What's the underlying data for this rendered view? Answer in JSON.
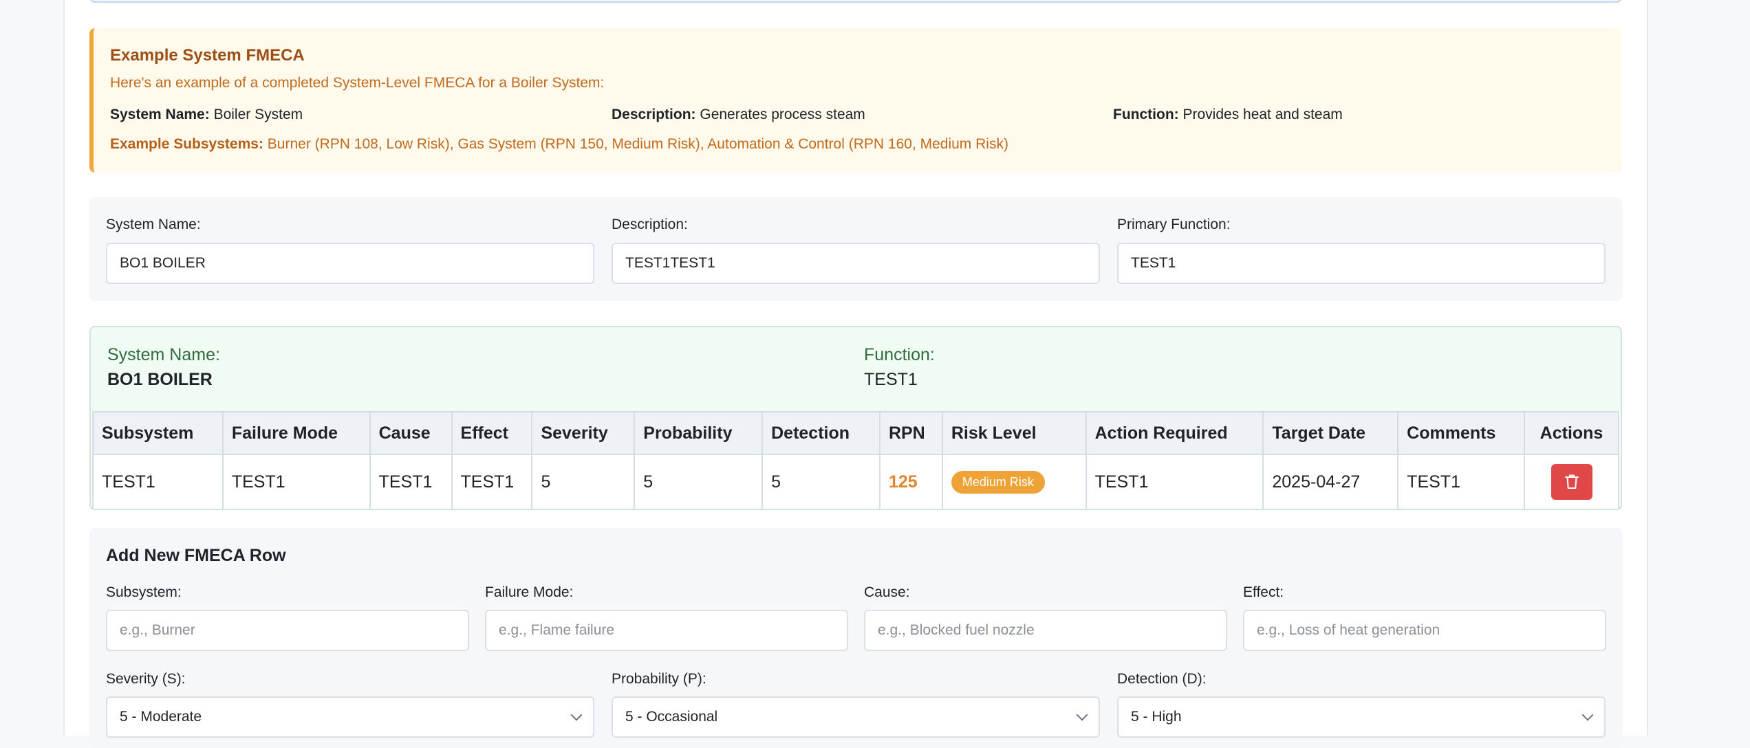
{
  "example": {
    "title": "Example System FMECA",
    "intro": "Here's an example of a completed System-Level FMECA for a Boiler System:",
    "system_name_label": "System Name:",
    "system_name_value": "Boiler System",
    "description_label": "Description:",
    "description_value": "Generates process steam",
    "function_label": "Function:",
    "function_value": "Provides heat and steam",
    "subsystems_label": "Example Subsystems:",
    "subsystems_value": "Burner (RPN 108, Low Risk), Gas System (RPN 150, Medium Risk), Automation & Control (RPN 160, Medium Risk)"
  },
  "info_form": {
    "system_name_label": "System Name:",
    "system_name_value": "BO1 BOILER",
    "description_label": "Description:",
    "description_value": "TEST1TEST1",
    "primary_function_label": "Primary Function:",
    "primary_function_value": "TEST1"
  },
  "summary": {
    "system_name_label": "System Name:",
    "system_name_value": "BO1 BOILER",
    "function_label": "Function:",
    "function_value": "TEST1"
  },
  "table": {
    "headers": [
      "Subsystem",
      "Failure Mode",
      "Cause",
      "Effect",
      "Severity",
      "Probability",
      "Detection",
      "RPN",
      "Risk Level",
      "Action Required",
      "Target Date",
      "Comments",
      "Actions"
    ],
    "rows": [
      {
        "subsystem": "TEST1",
        "failure_mode": "TEST1",
        "cause": "TEST1",
        "effect": "TEST1",
        "severity": "5",
        "probability": "5",
        "detection": "5",
        "rpn": "125",
        "risk_level": "Medium Risk",
        "action_required": "TEST1",
        "target_date": "2025-04-27",
        "comments": "TEST1"
      }
    ]
  },
  "add_form": {
    "title": "Add New FMECA Row",
    "subsystem_label": "Subsystem:",
    "subsystem_placeholder": "e.g., Burner",
    "failure_mode_label": "Failure Mode:",
    "failure_mode_placeholder": "e.g., Flame failure",
    "cause_label": "Cause:",
    "cause_placeholder": "e.g., Blocked fuel nozzle",
    "effect_label": "Effect:",
    "effect_placeholder": "e.g., Loss of heat generation",
    "severity_label": "Severity (S):",
    "severity_value": "5 - Moderate",
    "probability_label": "Probability (P):",
    "probability_value": "5 - Occasional",
    "detection_label": "Detection (D):",
    "detection_value": "5 - High"
  },
  "colors": {
    "accent_orange": "#f0a63b",
    "danger_red": "#e04848",
    "success_green_bg": "#f0fbf3"
  }
}
